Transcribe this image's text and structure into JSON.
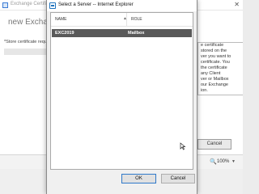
{
  "background_window": {
    "title": "Exchange Certificate",
    "heading": "new Exchange",
    "store_label": "*Store certificate reque",
    "help_lines": [
      "e certificate",
      "stored on the",
      "ver you want to",
      "certificate. You",
      "the certificate",
      "any Client",
      "ver or Mailbox",
      "our Exchange",
      "ion."
    ],
    "cancel_label": "Cancel",
    "zoom": "100%",
    "close_glyph": "✕"
  },
  "dialog": {
    "title": "Select a Server -- Internet Explorer",
    "columns": {
      "name": "NAME",
      "role": "ROLE"
    },
    "rows": [
      {
        "name": "EXC2019",
        "role": "Mailbox"
      }
    ],
    "ok_label": "OK",
    "cancel_label": "Cancel"
  },
  "icons": {
    "app": "exchange-app-icon",
    "ie": "internet-explorer-icon",
    "zoom": "zoom-icon",
    "sort": "sort-caret-icon",
    "cursor": "mouse-cursor-icon"
  }
}
